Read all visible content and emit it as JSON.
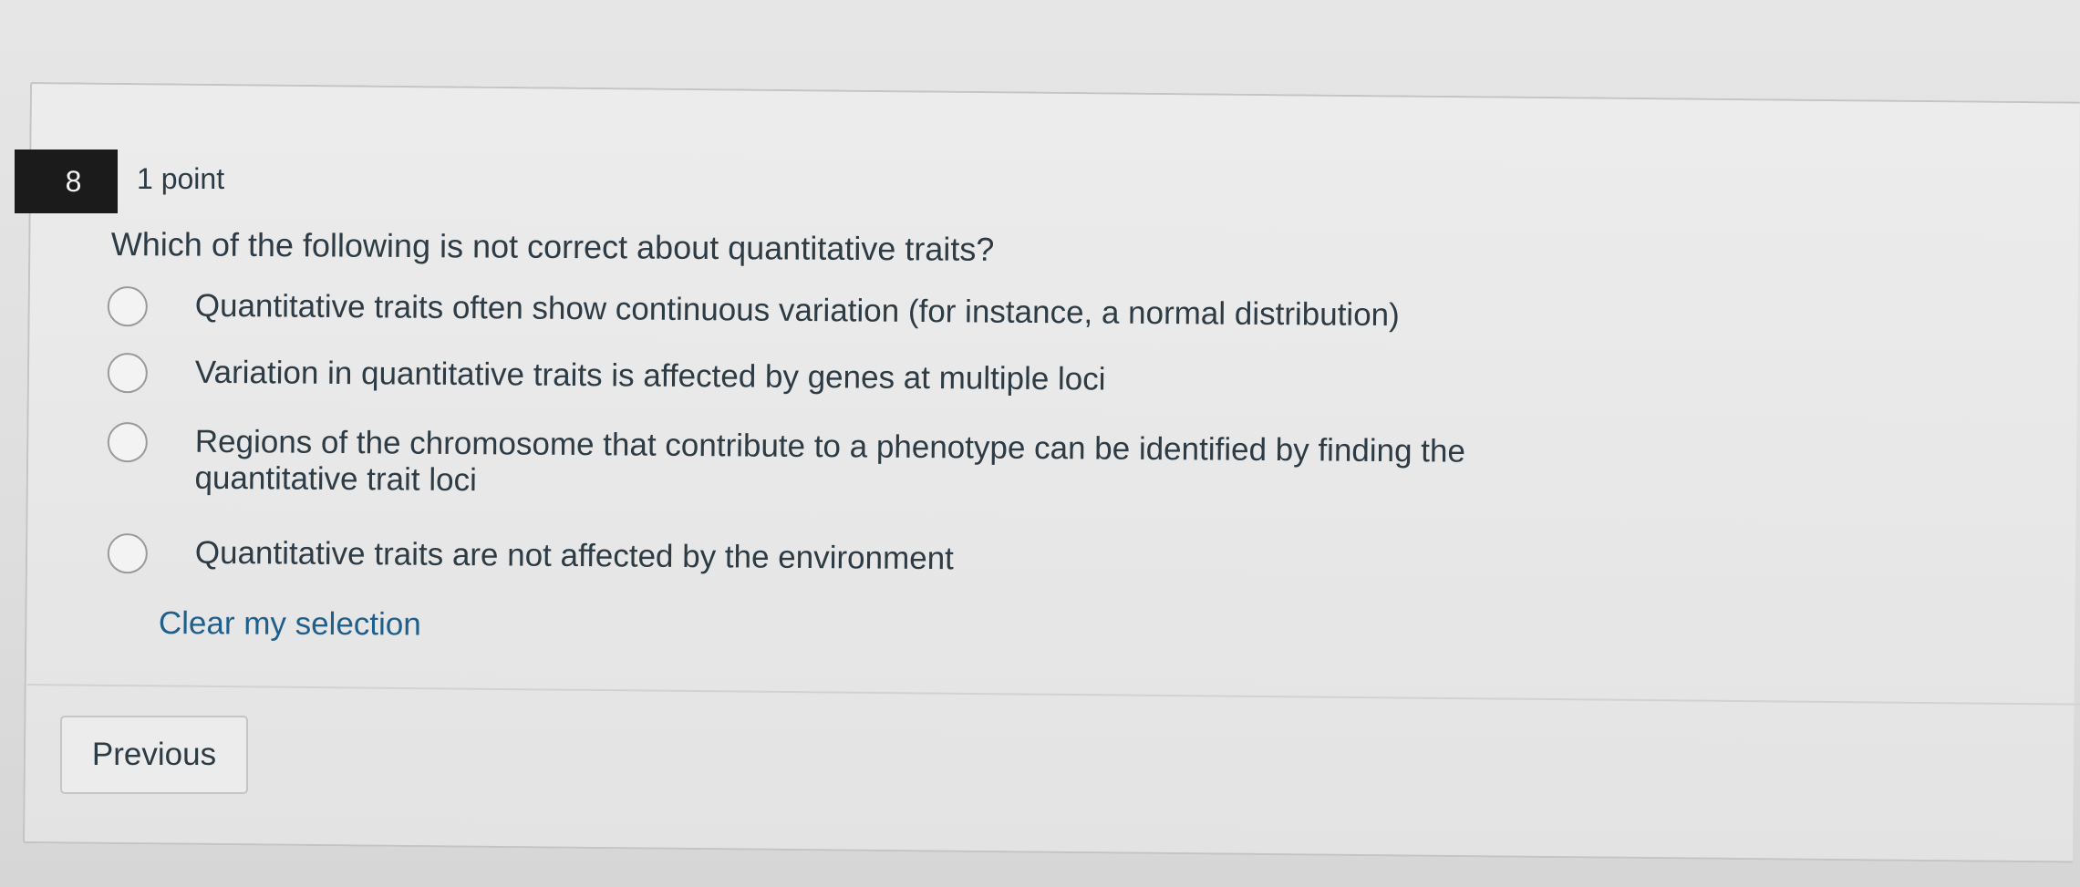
{
  "question": {
    "number": "8",
    "points": "1 point",
    "text": "Which of the following is not correct about quantitative traits?",
    "options": [
      {
        "label": "Quantitative traits often show continuous variation (for instance, a normal distribution)",
        "selected": false
      },
      {
        "label": "Variation in quantitative traits is affected by genes at multiple loci",
        "selected": false
      },
      {
        "label": "Regions of the chromosome that contribute to a phenotype can be identified by finding the quantitative trait loci",
        "selected": false
      },
      {
        "label": "Quantitative traits are not affected by the environment",
        "selected": false
      }
    ],
    "clear_label": "Clear my selection"
  },
  "navigation": {
    "previous_label": "Previous"
  },
  "colors": {
    "text": "#2d3b45",
    "link": "#1f5f8b",
    "number_badge": "#1b1b1b"
  }
}
